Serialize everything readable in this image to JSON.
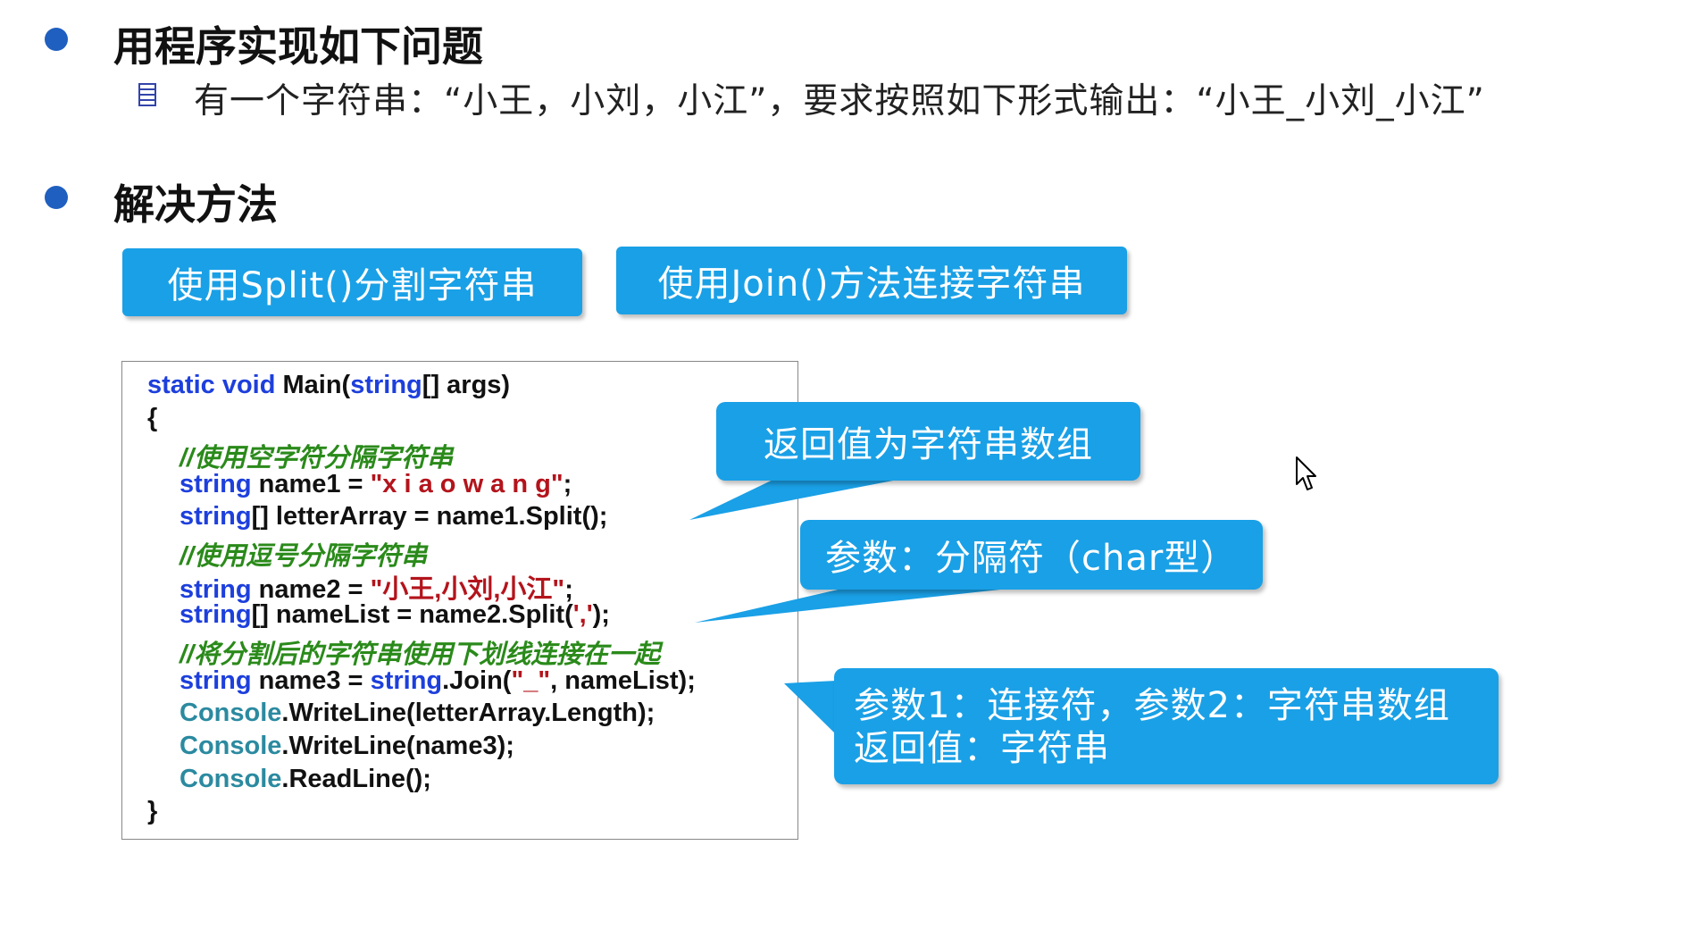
{
  "section1": {
    "heading": "用程序实现如下问题",
    "sub_item": "有一个字符串：“小王，小刘，小江”，要求按照如下形式输出：“小王_小刘_小江”"
  },
  "section2": {
    "heading": "解决方法",
    "buttons": [
      "使用Split()分割字符串",
      "使用Join()方法连接字符串"
    ]
  },
  "code": {
    "l1_kw1": "static void",
    "l1_mid": " Main(",
    "l1_kw2": "string",
    "l1_end": "[] args)",
    "l2": "{",
    "l3_comment": "//使用空字符分隔字符串",
    "l4_kw": "string",
    "l4_mid": " name1 = ",
    "l4_str": "\"x i a o w a n g\"",
    "l4_end": ";",
    "l5_kw": "string",
    "l5_rest": "[] letterArray = name1.Split();",
    "l6_comment": "//使用逗号分隔字符串",
    "l7_kw": "string",
    "l7_mid": " name2 = ",
    "l7_str": "\"小王,小刘,小江\"",
    "l7_end": ";",
    "l8_kw": "string",
    "l8_mid": "[] nameList = name2.Split(",
    "l8_str": "','",
    "l8_end": ");",
    "l9_comment": "//将分割后的字符串使用下划线连接在一起",
    "l10_kw1": "string",
    "l10_mid": " name3 = ",
    "l10_kw2": "string",
    "l10_mid2": ".Join(",
    "l10_str": "\"_\"",
    "l10_end": ", nameList);",
    "l11_cls": "Console",
    "l11_rest": ".WriteLine(letterArray.Length);",
    "l12_cls": "Console",
    "l12_rest": ".WriteLine(name3);",
    "l13_cls": "Console",
    "l13_rest": ".ReadLine();",
    "l14": "}"
  },
  "callouts": {
    "return_value": "返回值为字符串数组",
    "split_param": "参数：分隔符（char型）",
    "join_line1": "参数1：连接符，参数2：字符串数组",
    "join_line2": "返回值：字符串"
  },
  "colors": {
    "accent_blue": "#1aa0e6",
    "bullet_blue": "#1f5fbf",
    "keyword": "#1d3fdc",
    "string": "#b3141c",
    "comment": "#2a8a1a",
    "class": "#2b8aa0"
  },
  "icons": [
    "bullet-dot",
    "list-icon",
    "mouse-cursor-icon"
  ]
}
